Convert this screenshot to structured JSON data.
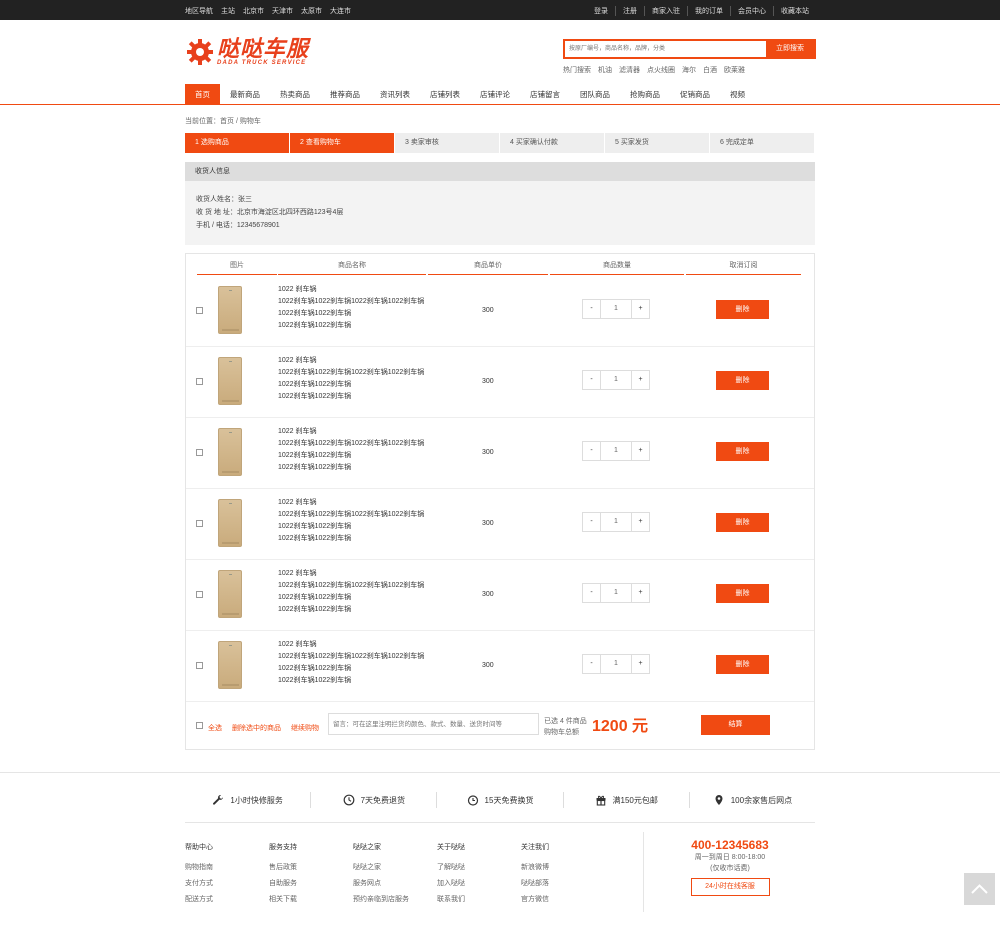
{
  "topbar": {
    "left": [
      "地区导航",
      "主站",
      "北京市",
      "天津市",
      "太原市",
      "大连市"
    ],
    "right": [
      "登录",
      "注册",
      "商家入驻",
      "我的订单",
      "会员中心",
      "收藏本站"
    ]
  },
  "header": {
    "logo_cn": "哒哒车服",
    "logo_en": "DADA TRUCK SERVICE",
    "search_placeholder": "按原厂编号，商品名称，品牌，分类",
    "search_button": "立即搜索",
    "hot": [
      "热门搜索",
      "机油",
      "滤清器",
      "点火线圈",
      "海尔",
      "白酒",
      "欧莱雅"
    ]
  },
  "nav": [
    "首页",
    "最新商品",
    "热卖商品",
    "推荐商品",
    "资讯列表",
    "店铺列表",
    "店铺评论",
    "店铺留言",
    "团队商品",
    "抢购商品",
    "促销商品",
    "视频"
  ],
  "breadcrumb": "当前位置：首页 / 购物车",
  "steps": [
    "1  选购商品",
    "2  查看购物车",
    "3  卖家审核",
    "4  买家确认付款",
    "5  买家发货",
    "6  完成定单"
  ],
  "receiver": {
    "title": "收货人信息",
    "name": "收货人姓名：张三",
    "address": "收 货 地 址：北京市海淀区北四环西路123号4层",
    "phone": "手机 / 电话：12345678901"
  },
  "cart": {
    "columns": [
      "图片",
      "商品名称",
      "商品单价",
      "商品数量",
      "取消订阅"
    ],
    "items": [
      {
        "l1": "1022 刹车锅",
        "l2": "1022刹车锅1022刹车锅1022刹车锅1022刹车锅",
        "l3": "1022刹车锅1022刹车锅",
        "l4": "1022刹车锅1022刹车锅",
        "price": "300",
        "minus": "-",
        "qty": "1",
        "plus": "+",
        "del": "删除"
      },
      {
        "l1": "1022 刹车锅",
        "l2": "1022刹车锅1022刹车锅1022刹车锅1022刹车锅",
        "l3": "1022刹车锅1022刹车锅",
        "l4": "1022刹车锅1022刹车锅",
        "price": "300",
        "minus": "-",
        "qty": "1",
        "plus": "+",
        "del": "删除"
      },
      {
        "l1": "1022 刹车锅",
        "l2": "1022刹车锅1022刹车锅1022刹车锅1022刹车锅",
        "l3": "1022刹车锅1022刹车锅",
        "l4": "1022刹车锅1022刹车锅",
        "price": "300",
        "minus": "-",
        "qty": "1",
        "plus": "+",
        "del": "删除"
      },
      {
        "l1": "1022 刹车锅",
        "l2": "1022刹车锅1022刹车锅1022刹车锅1022刹车锅",
        "l3": "1022刹车锅1022刹车锅",
        "l4": "1022刹车锅1022刹车锅",
        "price": "300",
        "minus": "-",
        "qty": "1",
        "plus": "+",
        "del": "删除"
      },
      {
        "l1": "1022 刹车锅",
        "l2": "1022刹车锅1022刹车锅1022刹车锅1022刹车锅",
        "l3": "1022刹车锅1022刹车锅",
        "l4": "1022刹车锅1022刹车锅",
        "price": "300",
        "minus": "-",
        "qty": "1",
        "plus": "+",
        "del": "删除"
      },
      {
        "l1": "1022 刹车锅",
        "l2": "1022刹车锅1022刹车锅1022刹车锅1022刹车锅",
        "l3": "1022刹车锅1022刹车锅",
        "l4": "1022刹车锅1022刹车锅",
        "price": "300",
        "minus": "-",
        "qty": "1",
        "plus": "+",
        "del": "删除"
      }
    ],
    "select_all": "全选",
    "delete_selected": "删除选中的商品",
    "continue": "继续购物",
    "message_placeholder": "留言：可在这里注明拦货的颜色、款式、数量、送货时间等",
    "selected_count": "已选 4 件商品",
    "total_label": "购物车总额",
    "total": "1200 元",
    "checkout": "结算"
  },
  "services": [
    "1小时快修服务",
    "7天免费退货",
    "15天免费换货",
    "满150元包邮",
    "100余家售后网点"
  ],
  "footer_cols": [
    {
      "title": "帮助中心",
      "items": [
        "购物指南",
        "支付方式",
        "配送方式"
      ]
    },
    {
      "title": "服务支持",
      "items": [
        "售后政策",
        "自助服务",
        "相关下载"
      ]
    },
    {
      "title": "哒哒之家",
      "items": [
        "哒哒之家",
        "服务网点",
        "预约亲临到店服务"
      ]
    },
    {
      "title": "关于哒哒",
      "items": [
        "了解哒哒",
        "加入哒哒",
        "联系我们"
      ]
    },
    {
      "title": "关注我们",
      "items": [
        "新浪微博",
        "哒哒部落",
        "官方微信"
      ]
    }
  ],
  "hotline": {
    "number": "400-12345683",
    "hours": "周一到周日 8:00-18:00",
    "note": "(仅收市话费)",
    "online": "24小时在线客服"
  },
  "colors": {
    "accent": "#f04a12",
    "topbar": "#222222"
  }
}
